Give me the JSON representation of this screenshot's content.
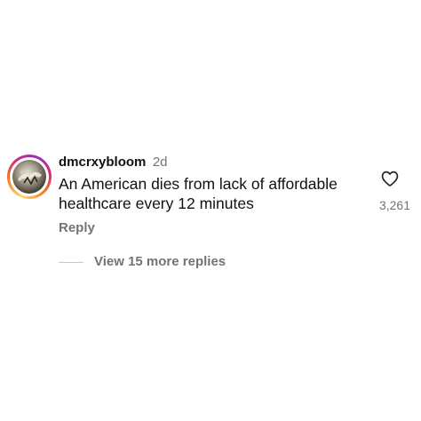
{
  "comment": {
    "username": "dmcrxybloom",
    "time": "2d",
    "text": "An American dies from lack of affordable healthcare every 12 minutes",
    "reply_label": "Reply",
    "like_count": "3,261",
    "view_replies_label": "View 15 more replies",
    "icons": {
      "like": "heart-outline-icon"
    }
  },
  "colors": {
    "text": "#111111",
    "secondary": "#737373",
    "background": "#ffffff",
    "story_ring": [
      "#feda75",
      "#fa7e1e",
      "#d62976",
      "#962fbf"
    ]
  }
}
